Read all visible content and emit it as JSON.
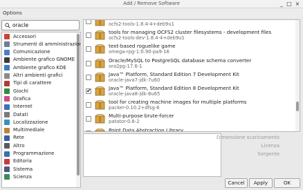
{
  "window": {
    "title": "Add / Remove Software",
    "minimize": "_",
    "maximize": "□",
    "close": "×"
  },
  "menu": {
    "options": "Options"
  },
  "search": {
    "value": "oracle"
  },
  "categories": [
    {
      "label": "Accessori",
      "color": "#c8453a"
    },
    {
      "label": "Strumenti di amministrazione",
      "color": "#6f7f8f"
    },
    {
      "label": "Comunicazione",
      "color": "#4a7fc8"
    },
    {
      "label": "Ambiente grafico GNOME",
      "color": "#3a3a3a"
    },
    {
      "label": "Ambiente grafico KDE",
      "color": "#3d78c9"
    },
    {
      "label": "Altri ambienti grafici",
      "color": "#8a8a8a"
    },
    {
      "label": "Tipi di carattere",
      "color": "#b03a3a"
    },
    {
      "label": "Giochi",
      "color": "#2f8f3f"
    },
    {
      "label": "Grafica",
      "color": "#d04a8a"
    },
    {
      "label": "Internet",
      "color": "#3a6fc0"
    },
    {
      "label": "Datati",
      "color": "#7a7a7a"
    },
    {
      "label": "Localizzazione",
      "color": "#3a8fc0"
    },
    {
      "label": "Multimediale",
      "color": "#c0803a"
    },
    {
      "label": "Rete",
      "color": "#3a5fa0"
    },
    {
      "label": "Altro",
      "color": "#5a5a5a"
    },
    {
      "label": "Programmazione",
      "color": "#3a70b0"
    },
    {
      "label": "Editoria",
      "color": "#c83a3a"
    },
    {
      "label": "Sistema",
      "color": "#4a5a7a"
    },
    {
      "label": "Scienza",
      "color": "#3a8a5a"
    }
  ],
  "packages": [
    {
      "desc": "",
      "name": "ocfs2-tools-1.8.4-4+deb9u1",
      "checked": false
    },
    {
      "desc": "tools for managing OCFS2 cluster filesystems - development files",
      "name": "ocfs2-tools-dev-1.8.4-4+deb9u1",
      "checked": false
    },
    {
      "desc": "text-based roguelike game",
      "name": "omega-rpg-1:0.90-pa9-16",
      "checked": false
    },
    {
      "desc": "Oracle/MySQL to PostgreSQL database schema converter",
      "name": "ora2pg-17.6-1",
      "checked": false
    },
    {
      "desc": "Java™ Platform, Standard Edition 7 Development Kit",
      "name": "oracle-java7-jdk-7u60",
      "checked": false
    },
    {
      "desc": "Java™ Platform, Standard Edition 8 Development Kit",
      "name": "oracle-java8-jdk-8u65",
      "checked": true
    },
    {
      "desc": "tool for creating machine images for multiple platforms",
      "name": "packer-0.10.2+dfsg-6",
      "checked": false
    },
    {
      "desc": "Multi-purpose brute-forcer",
      "name": "patator-0.6-2",
      "checked": false
    },
    {
      "desc": "Point Data Abstraction Library",
      "name": "pdal-1.4.0-1",
      "checked": false
    }
  ],
  "details": {
    "download_size": "Dimensione scaricamento",
    "license": "Licenza",
    "source": "Sorgente"
  },
  "buttons": {
    "cancel": "Cancel",
    "apply": "Apply",
    "ok": "OK"
  },
  "colors": {
    "accent": "#d9a441",
    "selection": "#c8c8c8"
  }
}
